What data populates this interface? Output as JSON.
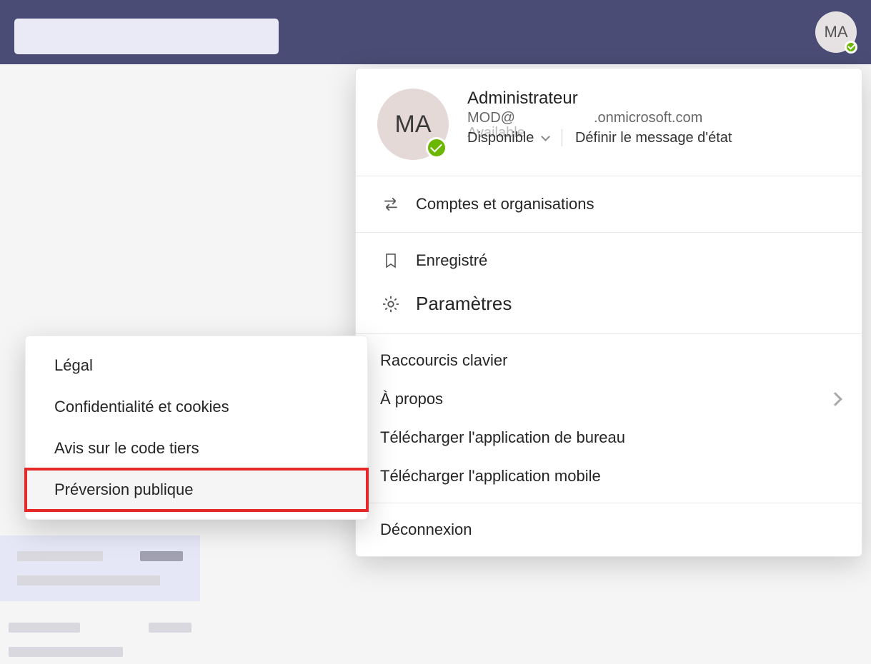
{
  "avatar": {
    "initials": "MA"
  },
  "profile": {
    "name": "Administrateur",
    "email_prefix": "MOD@",
    "email_domain": ".onmicrosoft.com",
    "status_ghost": "Available",
    "status": "Disponible",
    "set_status_msg": "Définir le message d'état"
  },
  "menu": {
    "accounts": "Comptes et organisations",
    "saved": "Enregistré",
    "settings": "Paramètres",
    "shortcuts": "Raccourcis clavier",
    "about": "À propos",
    "download_desktop": "Télécharger l'application de bureau",
    "download_mobile": "Télécharger l'application mobile",
    "signout": "Déconnexion"
  },
  "submenu": {
    "legal": "Légal",
    "privacy": "Confidentialité et cookies",
    "third_party": "Avis sur le code tiers",
    "public_preview": "Préversion publique"
  }
}
